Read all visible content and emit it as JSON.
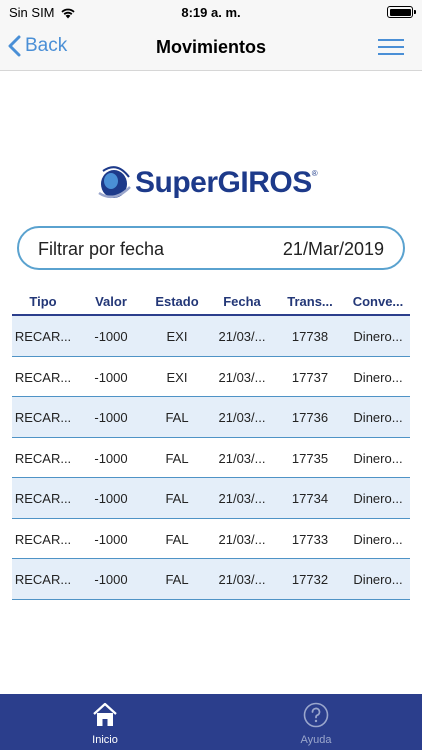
{
  "status_bar": {
    "carrier": "Sin SIM",
    "time": "8:19 a. m.",
    "battery_level": 1.0
  },
  "nav": {
    "back_label": "Back",
    "title": "Movimientos"
  },
  "logo": {
    "text": "SuperGIROS",
    "mark": "®"
  },
  "filter": {
    "label": "Filtrar por fecha",
    "value": "21/Mar/2019"
  },
  "table": {
    "headers": [
      "Tipo",
      "Valor",
      "Estado",
      "Fecha",
      "Trans...",
      "Conve..."
    ],
    "rows": [
      [
        "RECAR...",
        "-1000",
        "EXI",
        "21/03/...",
        "17738",
        "Dinero..."
      ],
      [
        "RECAR...",
        "-1000",
        "EXI",
        "21/03/...",
        "17737",
        "Dinero..."
      ],
      [
        "RECAR...",
        "-1000",
        "FAL",
        "21/03/...",
        "17736",
        "Dinero..."
      ],
      [
        "RECAR...",
        "-1000",
        "FAL",
        "21/03/...",
        "17735",
        "Dinero..."
      ],
      [
        "RECAR...",
        "-1000",
        "FAL",
        "21/03/...",
        "17734",
        "Dinero..."
      ],
      [
        "RECAR...",
        "-1000",
        "FAL",
        "21/03/...",
        "17733",
        "Dinero..."
      ],
      [
        "RECAR...",
        "-1000",
        "FAL",
        "21/03/...",
        "17732",
        "Dinero..."
      ]
    ]
  },
  "tab_bar": {
    "home_label": "Inicio",
    "help_label": "Ayuda",
    "home_icon": "house-icon",
    "help_icon": "question-circle-icon"
  },
  "colors": {
    "accent": "#4a8fd6",
    "brand_navy": "#2b3e8c",
    "row_alt": "#e4eef9",
    "filter_border": "#5aa2cf"
  }
}
